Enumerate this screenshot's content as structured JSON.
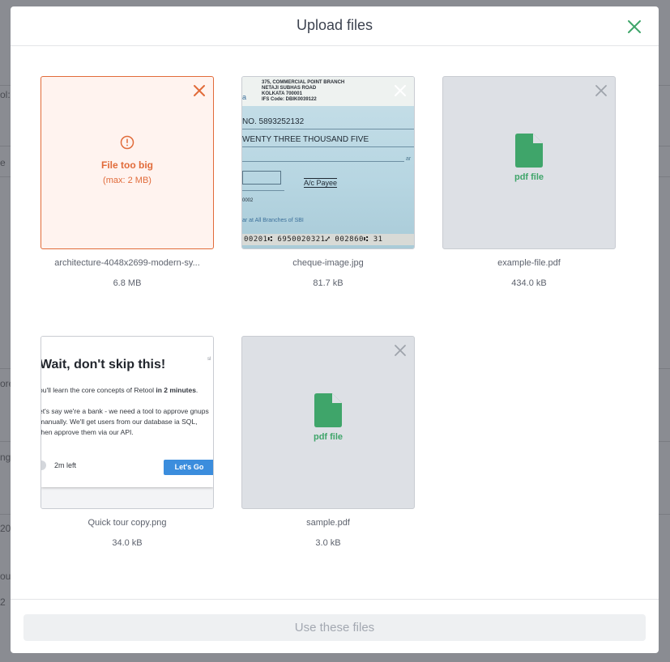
{
  "modal": {
    "title": "Upload files",
    "submit_label": "Use these files"
  },
  "colors": {
    "error": "#e16b3a",
    "pdf_green": "#3fa56a",
    "text": "#5d626d"
  },
  "files": [
    {
      "name": "architecture-4048x2699-modern-sy...",
      "size": "6.8 MB",
      "state": "error",
      "error_title": "File too big",
      "error_detail": "(max: 2 MB)",
      "icon": "alert-circle-icon"
    },
    {
      "name": "cheque-image.jpg",
      "size": "81.7 kB",
      "state": "image",
      "preview": {
        "bank_header": [
          "375, COMMERCIAL POINT BRANCH",
          "NETAJI SUBHAS ROAD",
          "KOLKATA 700001",
          "IFS Code: DBIK0039122"
        ],
        "account_no": "NO. 5893252132",
        "amount_words": "WENTY THREE THOUSAND FIVE",
        "payee_mark": "A/c Payee",
        "branch_note": "ar at All Branches of SBI",
        "micr": "00201⑆ 6950020321⑇ 002860⑆ 31",
        "code_fragment": "0002",
        "edge_letter": "a",
        "edge_right": "ar"
      }
    },
    {
      "name": "example-file.pdf",
      "size": "434.0 kB",
      "state": "pdf",
      "type_label": "pdf file",
      "icon": "file-icon"
    },
    {
      "name": "Quick tour copy.png",
      "size": "34.0 kB",
      "state": "image",
      "preview": {
        "heading": "Wait, don't skip this!",
        "line1_pre": "ou'll learn the core concepts of Retool ",
        "line1_bold": "in 2 minutes",
        "line1_post": ".",
        "paragraph": "et's say we're a bank - we need a tool to approve gnups manually. We'll get users from our database ia SQL, then approve them via our API.",
        "timer": "2m left",
        "button": "Let's Go",
        "corner": "sl"
      }
    },
    {
      "name": "sample.pdf",
      "size": "3.0 kB",
      "state": "pdf",
      "type_label": "pdf file",
      "icon": "file-icon"
    }
  ],
  "background": {
    "edge_fragments": [
      "ol:",
      "e",
      "ore",
      "ng",
      "20",
      "ou",
      "2"
    ]
  }
}
